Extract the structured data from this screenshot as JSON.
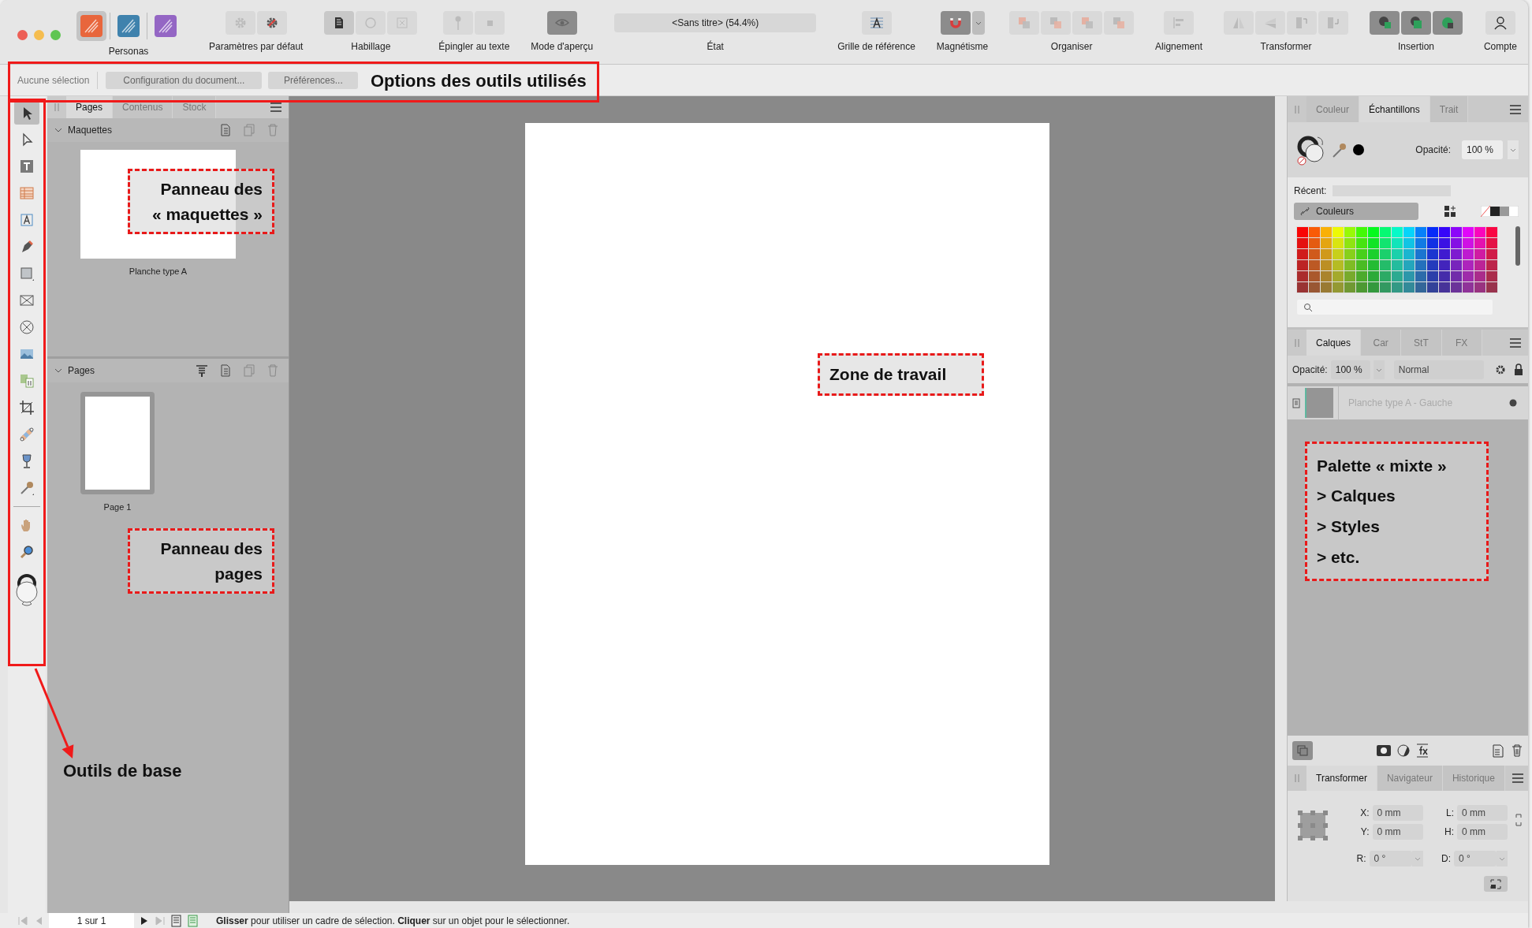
{
  "toolbar": {
    "personas": {
      "label": "Personas",
      "items": [
        {
          "color": "#e8663c",
          "selected": true
        },
        {
          "color": "#3f82ad",
          "selected": false
        },
        {
          "color": "#9466c4",
          "selected": false
        }
      ]
    },
    "groups": [
      {
        "kind": "defaults",
        "label": "Paramètres par défaut"
      },
      {
        "kind": "wrap",
        "label": "Habillage"
      },
      {
        "kind": "pin",
        "label": "Épingler au texte"
      },
      {
        "kind": "preview",
        "label": "Mode d'aperçu"
      },
      {
        "kind": "status",
        "label": "État",
        "value": "<Sans titre> (54.4%)"
      },
      {
        "kind": "grid",
        "label": "Grille de référence"
      },
      {
        "kind": "snap",
        "label": "Magnétisme"
      },
      {
        "kind": "arrange",
        "label": "Organiser"
      },
      {
        "kind": "align",
        "label": "Alignement"
      },
      {
        "kind": "transform",
        "label": "Transformer"
      },
      {
        "kind": "insert",
        "label": "Insertion"
      },
      {
        "kind": "account",
        "label": "Compte"
      }
    ]
  },
  "context_bar": {
    "selection": "Aucune sélection",
    "buttons": [
      "Configuration du document...",
      "Préférences..."
    ]
  },
  "tools": [
    {
      "kind": "pointer",
      "selected": true
    },
    {
      "kind": "node",
      "selected": false
    },
    {
      "kind": "text-frame",
      "selected": false
    },
    {
      "kind": "table",
      "selected": false
    },
    {
      "kind": "artistic-text",
      "selected": false
    },
    {
      "kind": "pen",
      "selected": false
    },
    {
      "kind": "rectangle",
      "selected": false
    },
    {
      "kind": "frame-rect",
      "selected": false
    },
    {
      "kind": "frame-ellipse",
      "selected": false
    },
    {
      "kind": "image",
      "selected": false
    },
    {
      "kind": "swap",
      "selected": false
    },
    {
      "kind": "crop",
      "selected": false
    },
    {
      "kind": "gradient",
      "selected": false
    },
    {
      "kind": "fill",
      "selected": false
    },
    {
      "kind": "picker",
      "selected": false
    },
    {
      "kind": "divider",
      "selected": false
    },
    {
      "kind": "hand",
      "selected": false
    },
    {
      "kind": "zoom",
      "selected": false
    },
    {
      "kind": "wells",
      "selected": false
    }
  ],
  "pages_panel": {
    "tabs": [
      {
        "label": "Pages",
        "selected": true
      },
      {
        "label": "Contenus",
        "selected": false
      },
      {
        "label": "Stock",
        "selected": false
      }
    ],
    "masters": {
      "title": "Maquettes",
      "expanded": true,
      "items": [
        {
          "label": "Planche type A",
          "selected": false
        }
      ]
    },
    "pages": {
      "title": "Pages",
      "expanded": true,
      "items": [
        {
          "label": "Page 1",
          "selected": true
        }
      ]
    }
  },
  "color_panel": {
    "tabs": [
      {
        "label": "Couleur",
        "selected": false
      },
      {
        "label": "Échantillons",
        "selected": true
      },
      {
        "label": "Trait",
        "selected": false
      }
    ],
    "opacity_label": "Opacité:",
    "opacity": "100 %",
    "recent_label": "Récent:",
    "palette": "Couleurs"
  },
  "layers_panel": {
    "tabs": [
      {
        "label": "Calques",
        "selected": true
      },
      {
        "label": "Car",
        "selected": false
      },
      {
        "label": "StT",
        "selected": false
      },
      {
        "label": "FX",
        "selected": false
      }
    ],
    "opacity_label": "Opacité:",
    "opacity": "100 %",
    "blend": "Normal",
    "layers": [
      {
        "name": "Planche type A - Gauche"
      }
    ]
  },
  "transform_panel": {
    "tabs": [
      {
        "label": "Transformer",
        "selected": true
      },
      {
        "label": "Navigateur",
        "selected": false
      },
      {
        "label": "Historique",
        "selected": false
      }
    ],
    "fields": [
      {
        "label": "X:",
        "value": "0 mm",
        "kind": "text"
      },
      {
        "label": "L:",
        "value": "0 mm",
        "kind": "text"
      },
      {
        "label": "Y:",
        "value": "0 mm",
        "kind": "text"
      },
      {
        "label": "H:",
        "value": "0 mm",
        "kind": "text"
      },
      {
        "label": "R:",
        "value": "0 °",
        "kind": "dropdown"
      },
      {
        "label": "D:",
        "value": "0 °",
        "kind": "dropdown"
      }
    ]
  },
  "status_bar": {
    "page": "1 sur 1",
    "message": "**Glisser** pour utiliser un cadre de sélection. **Cliquer** sur un objet pour le sélectionner."
  },
  "annotations": [
    {
      "kind": "frame",
      "lines": [
        "Options des outils utilisés"
      ]
    },
    {
      "kind": "frame-arrow",
      "lines": [
        "Outils de base"
      ]
    },
    {
      "kind": "callout",
      "lines": [
        "Panneau des",
        "« maquettes »"
      ]
    },
    {
      "kind": "callout",
      "lines": [
        "Panneau des",
        "pages"
      ]
    },
    {
      "kind": "callout",
      "lines": [
        "Zone de travail"
      ]
    },
    {
      "kind": "callout",
      "lines": [
        "Palette « mixte »",
        "> Calques",
        "> Styles",
        "> etc."
      ]
    }
  ]
}
